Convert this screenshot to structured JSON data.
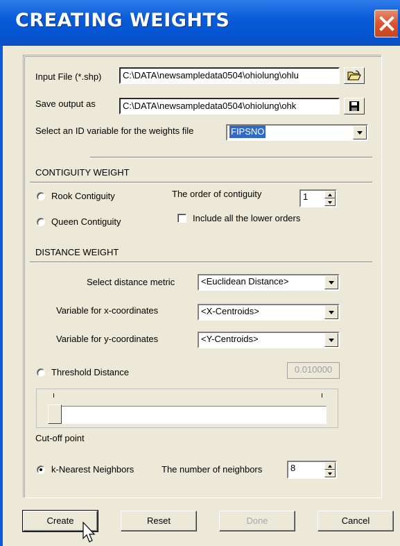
{
  "window": {
    "title": "CREATING WEIGHTS",
    "close_icon": "close-icon"
  },
  "input_file": {
    "label": "Input File (*.shp)",
    "value": "C:\\DATA\\newsampledata0504\\ohiolung\\ohlu",
    "icon": "folder-open-icon"
  },
  "save_output": {
    "label": "Save output as",
    "value": "C:\\DATA\\newsampledata0504\\ohiolung\\ohk",
    "icon": "floppy-disk-icon"
  },
  "id_variable": {
    "label": "Select an ID variable for the weights file",
    "value": "FIPSNO"
  },
  "contiguity": {
    "heading": "CONTIGUITY WEIGHT",
    "rook_label": "Rook Contiguity",
    "queen_label": "Queen Contiguity",
    "order_label": "The order of contiguity",
    "order_value": "1",
    "lower_orders_label": "Include all the lower orders"
  },
  "distance": {
    "heading": "DISTANCE WEIGHT",
    "metric_label": "Select distance metric",
    "metric_value": "<Euclidean Distance>",
    "x_label": "Variable for x-coordinates",
    "x_value": "<X-Centroids>",
    "y_label": "Variable for y-coordinates",
    "y_value": "<Y-Centroids>",
    "threshold_label": "Threshold Distance",
    "threshold_value": "0.010000",
    "cutoff_label": "Cut-off point",
    "knn_label": "k-Nearest Neighbors",
    "neighbors_label": "The number of neighbors",
    "neighbors_value": "8",
    "selected_option": "k-Nearest Neighbors"
  },
  "buttons": {
    "create": "Create",
    "reset": "Reset",
    "done": "Done",
    "cancel": "Cancel"
  }
}
